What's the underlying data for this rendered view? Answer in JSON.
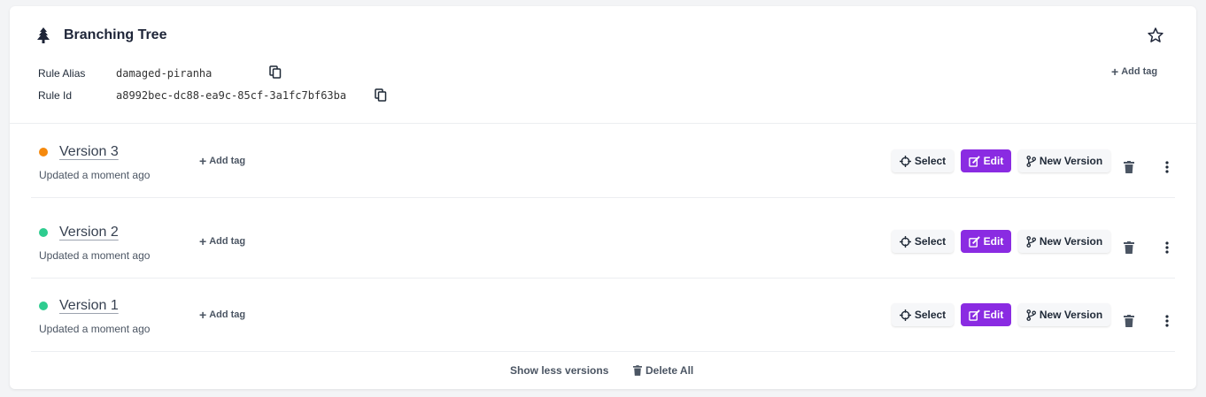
{
  "rule": {
    "title": "Branching Tree",
    "alias_label": "Rule Alias",
    "alias_value": "damaged-piranha",
    "id_label": "Rule Id",
    "id_value": "a8992bec-dc88-ea9c-85cf-3a1fc7bf63ba",
    "add_tag_label": "Add tag"
  },
  "versions": [
    {
      "name": "Version 3",
      "updated": "Updated a moment ago",
      "status_color": "#f5890d",
      "add_tag_label": "Add tag"
    },
    {
      "name": "Version 2",
      "updated": "Updated a moment ago",
      "status_color": "#2ecc8f",
      "add_tag_label": "Add tag"
    },
    {
      "name": "Version 1",
      "updated": "Updated a moment ago",
      "status_color": "#2ecc8f",
      "add_tag_label": "Add tag"
    }
  ],
  "actions": {
    "select_label": "Select",
    "edit_label": "Edit",
    "new_version_label": "New Version"
  },
  "footer": {
    "show_less_label": "Show less versions",
    "delete_all_label": "Delete All"
  },
  "colors": {
    "accent": "#8a2be2",
    "title": "#1e2538"
  },
  "icons": [
    "tree-icon",
    "star-icon",
    "copy-icon",
    "plus-icon",
    "crosshair-icon",
    "edit-icon",
    "branch-icon",
    "trash-icon",
    "kebab-icon"
  ]
}
